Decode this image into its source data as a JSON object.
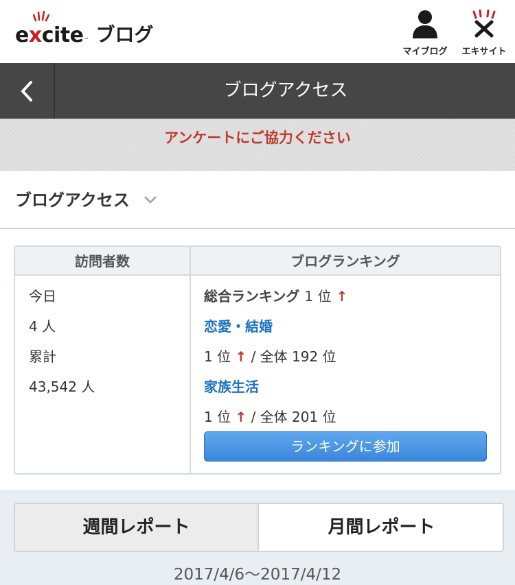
{
  "header": {
    "logo_text_pre": "e",
    "logo_text_x": "x",
    "logo_text_post": "cite",
    "logo_tm": "™",
    "logo_suffix": "ブログ",
    "myblog_label": "マイブログ",
    "excite_label": "エキサイト"
  },
  "titlebar": {
    "title": "ブログアクセス"
  },
  "survey": {
    "label": "アンケートにご協力ください"
  },
  "section": {
    "title": "ブログアクセス"
  },
  "stats": {
    "visitors_header": "訪問者数",
    "ranking_header": "ブログランキング",
    "today_label": "今日",
    "today_value": "4 人",
    "total_label": "累計",
    "total_value": "43,542 人",
    "overall_label": "総合ランキング",
    "overall_rank": "1 位",
    "category1_name": "恋愛・結婚",
    "category1_rank": "1 位",
    "category1_overall": "/ 全体 192 位",
    "category2_name": "家族生活",
    "category2_rank": "1 位",
    "category2_overall": "/ 全体 201 位",
    "up_arrow": "↑",
    "join_button": "ランキングに参加"
  },
  "report": {
    "weekly_tab": "週間レポート",
    "monthly_tab": "月間レポート",
    "date_range": "2017/4/6〜2017/4/12"
  },
  "colors": {
    "titlebar_bg": "#464646",
    "survey_text": "#c0392b",
    "link_blue": "#1a73c8",
    "up_arrow_red": "#c0392b",
    "button_blue": "#3b86dc"
  }
}
